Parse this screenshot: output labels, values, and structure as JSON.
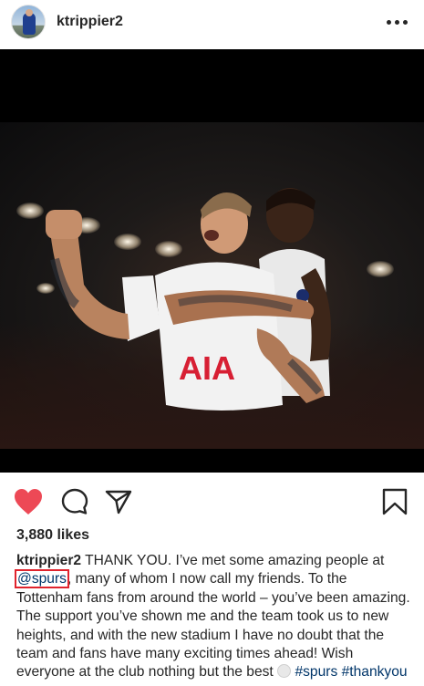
{
  "post": {
    "username": "ktrippier2",
    "more_icon": "more-horizontal-icon"
  },
  "photo": {
    "shirt_sponsor": "AIA",
    "description_colors": {
      "shirt": "#f2f2f2",
      "sponsor": "#d71f33",
      "background": "#0c0c0d"
    }
  },
  "actions": {
    "like_icon": "heart-filled-icon",
    "comment_icon": "comment-icon",
    "share_icon": "paper-plane-icon",
    "save_icon": "bookmark-icon",
    "like_color": "#ed4956"
  },
  "likes": "3,880 likes",
  "caption": {
    "username": "ktrippier2",
    "text_1": "THANK YOU. I’ve met some amazing people at ",
    "mention": "@spurs",
    "text_2": ", many of whom I now call my friends. To the Tottenham fans from around the world – you’ve been amazing. The support you’ve shown me and the team took us to new heights, and with the new stadium I have no doubt that the team and fans have many exciting times ahead! Wish everyone at the club nothing but the best ",
    "hashtag_1": "#spurs",
    "hashtag_2": "#thankyou"
  }
}
